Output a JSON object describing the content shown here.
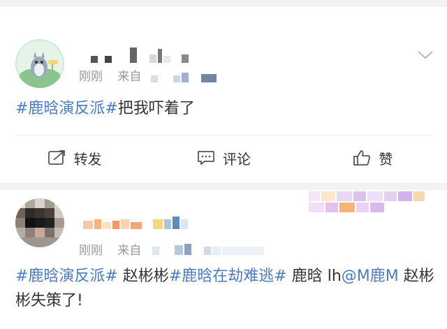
{
  "feed": {
    "posts": [
      {
        "avatar": "totoro-avatar",
        "time": "刚刚",
        "source_prefix": "来自",
        "text_parts": [
          {
            "type": "topic",
            "text": "#鹿晗演反派#"
          },
          {
            "type": "text",
            "text": "把我吓着了"
          }
        ],
        "actions": {
          "repost_label": "转发",
          "comment_label": "评论",
          "like_label": "赞"
        }
      },
      {
        "avatar": "user-avatar-blurred",
        "time": "刚刚",
        "source_prefix": "来自",
        "text_parts": [
          {
            "type": "topic",
            "text": "#鹿晗演反派#"
          },
          {
            "type": "text",
            "text": " 赵彬彬"
          },
          {
            "type": "topic",
            "text": "#鹿晗在劫难逃#"
          },
          {
            "type": "text",
            "text": " 鹿晗 lh"
          },
          {
            "type": "mention",
            "text": "@M鹿M"
          },
          {
            "type": "text",
            "text": " 赵彬彬失策了!"
          }
        ]
      }
    ]
  },
  "colors": {
    "link": "#4b7cc2",
    "meta": "#999999",
    "background": "#f2f2f2"
  },
  "icons": [
    "chevron-down-icon",
    "repost-icon",
    "comment-icon",
    "like-icon"
  ]
}
